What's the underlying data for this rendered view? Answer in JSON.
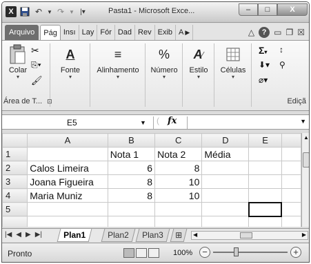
{
  "window": {
    "title": "Pasta1 - Microsoft Exce...",
    "app_icon": "X",
    "controls": {
      "minimize": "–",
      "maximize": "□",
      "close": "X"
    }
  },
  "ribbon_tabs": {
    "file": "Arquivo",
    "items": [
      "Pág",
      "Insı",
      "Lay",
      "Fór",
      "Dad",
      "Rev",
      "Exib",
      "A"
    ],
    "active_index": 0
  },
  "ribbon": {
    "groups": {
      "clipboard": {
        "paste_label": "Colar",
        "group_label": "Área de T..."
      },
      "font": {
        "label": "Fonte",
        "icon_glyph": "A"
      },
      "alignment": {
        "label": "Alinhamento"
      },
      "number": {
        "label": "Número",
        "icon_glyph": "%"
      },
      "style": {
        "label": "Estilo"
      },
      "cells": {
        "label": "Células"
      },
      "editing": {
        "label": "Ediçã",
        "sigma": "Σ"
      }
    }
  },
  "formula_bar": {
    "name_box": "E5",
    "fx_label": "fx",
    "formula": ""
  },
  "sheet": {
    "columns": [
      "A",
      "B",
      "C",
      "D",
      "E"
    ],
    "rows": [
      {
        "n": "1",
        "cells": [
          "",
          "Nota 1",
          "Nota 2",
          "Média",
          ""
        ]
      },
      {
        "n": "2",
        "cells": [
          "Calos Limeira",
          "6",
          "8",
          "",
          ""
        ]
      },
      {
        "n": "3",
        "cells": [
          "Joana Figueira",
          "8",
          "10",
          "",
          ""
        ]
      },
      {
        "n": "4",
        "cells": [
          "Maria Muniz",
          "8",
          "10",
          "",
          ""
        ]
      },
      {
        "n": "5",
        "cells": [
          "",
          "",
          "",
          "",
          ""
        ]
      }
    ],
    "selected_cell": "E5"
  },
  "sheet_tabs": [
    "Plan1",
    "Plan2",
    "Plan3"
  ],
  "active_sheet": "Plan1",
  "status": {
    "ready": "Pronto",
    "zoom": "100%"
  }
}
